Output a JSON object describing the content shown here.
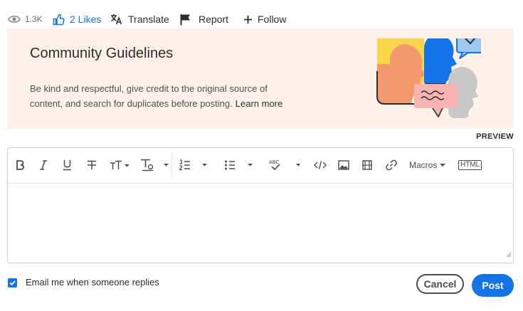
{
  "action_bar": {
    "views": "1.3K",
    "likes": "2 Likes",
    "translate": "Translate",
    "report": "Report",
    "follow": "Follow"
  },
  "guidelines": {
    "title": "Community Guidelines",
    "body": "Be kind and respectful, give credit to the original source of content, and search for duplicates before posting.",
    "learn_more": "Learn more"
  },
  "preview_label": "PREVIEW",
  "editor": {
    "toolbar": {
      "macros": "Macros",
      "html": "HTML"
    },
    "content": ""
  },
  "footer": {
    "email_checkbox_checked": true,
    "email_label": "Email me when someone replies",
    "cancel": "Cancel",
    "post": "Post"
  },
  "colors": {
    "accent": "#1473e6",
    "banner_bg": "#fdf1e9",
    "text": "#2c2c2c"
  }
}
